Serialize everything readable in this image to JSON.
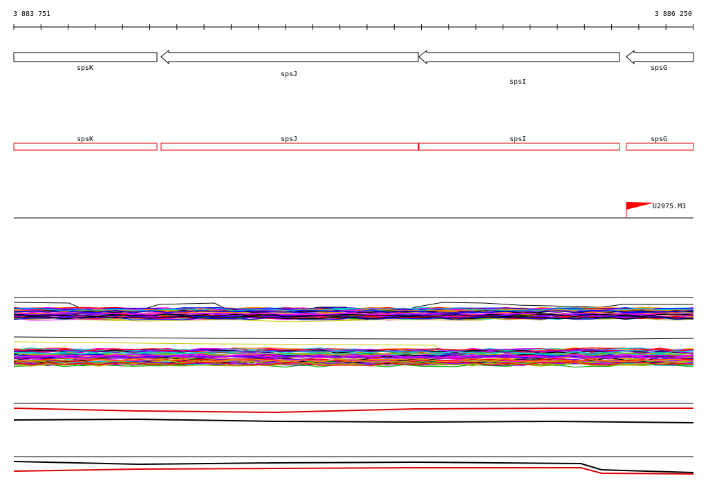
{
  "coordinates": {
    "start_label": "3 883 751",
    "end_label": "3 886 250"
  },
  "genes": [
    {
      "name": "spsK",
      "strand": "-"
    },
    {
      "name": "spsJ",
      "strand": "-"
    },
    {
      "name": "spsI",
      "strand": "-"
    },
    {
      "name": "spsG",
      "strand": "-"
    }
  ],
  "transcripts": [
    {
      "name": "spsK"
    },
    {
      "name": "spsJ"
    },
    {
      "name": "spsI"
    },
    {
      "name": "spsG"
    }
  ],
  "promoter": {
    "name": "U2975.M3",
    "color": "#ff0000"
  },
  "colors": {
    "gene_stroke": "#000000",
    "transcript_stroke": "#dd0000",
    "track_palette": [
      "#ff0000",
      "#0000ff",
      "#00aa00",
      "#ff00ff",
      "#00cccc",
      "#aaaa00",
      "#ff8800",
      "#8800ff",
      "#000000"
    ]
  }
}
